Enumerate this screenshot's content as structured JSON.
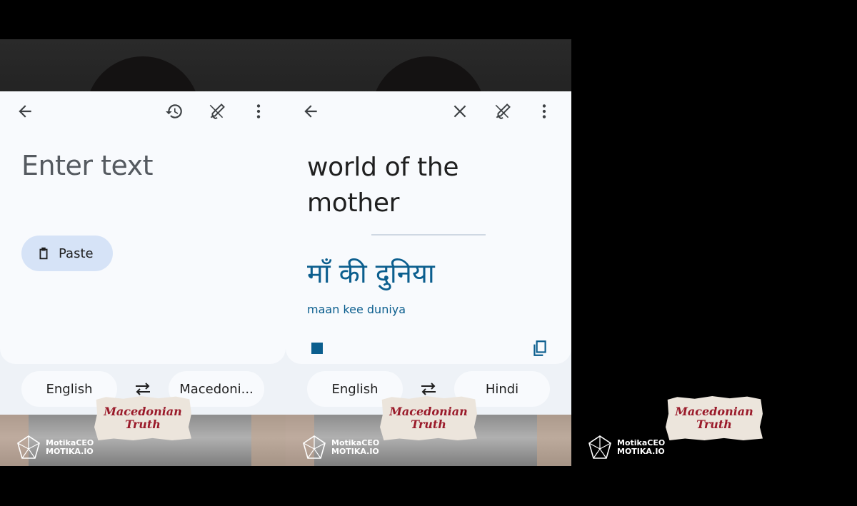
{
  "screen1": {
    "input_placeholder": "Enter text",
    "paste_label": "Paste",
    "source_language": "English",
    "target_language": "Macedoni..."
  },
  "screen2": {
    "source_text": "world of the mother",
    "translated_text": "माँ की दुनिया",
    "transliteration": "maan kee duniya",
    "source_language": "English",
    "target_language": "Hindi"
  },
  "watermark": {
    "sticker_line1": "Macedonian",
    "sticker_line2": "Truth",
    "brand_name": "MotikaCEO",
    "brand_site": "MOTIKA.IO"
  },
  "icons": {
    "back": "arrow-left-icon",
    "history": "history-icon",
    "handwriting": "handwriting-pen-icon",
    "more": "more-vertical-icon",
    "close": "close-icon",
    "clipboard": "clipboard-icon",
    "swap": "swap-arrows-icon",
    "stop": "stop-icon",
    "copy": "copy-icon"
  },
  "colors": {
    "accent": "#0b5e8e",
    "card_bg": "#f8fafd",
    "paste_bg": "#d6e3f7",
    "sticker_text": "#9a1a2a"
  }
}
